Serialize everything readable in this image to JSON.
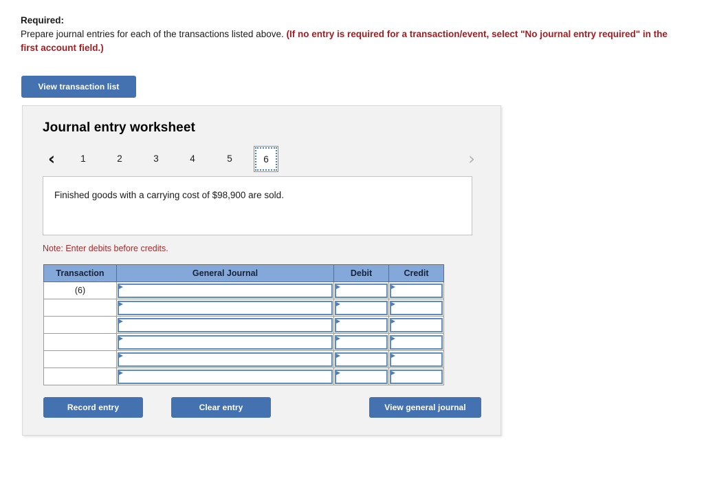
{
  "instructions": {
    "heading": "Required:",
    "body_plain": "Prepare journal entries for each of the transactions listed above. ",
    "body_emphasis": "(If no entry is required for a transaction/event, select \"No journal entry required\" in the first account field.)"
  },
  "toolbar": {
    "view_transaction_list": "View transaction list"
  },
  "worksheet": {
    "title": "Journal entry worksheet",
    "prev_icon": "chevron-left-icon",
    "next_icon": "chevron-right-icon",
    "prev_glyph": "‹",
    "next_glyph": "›",
    "tabs": [
      {
        "label": "1",
        "selected": false
      },
      {
        "label": "2",
        "selected": false
      },
      {
        "label": "3",
        "selected": false
      },
      {
        "label": "4",
        "selected": false
      },
      {
        "label": "5",
        "selected": false
      },
      {
        "label": "6",
        "selected": true
      }
    ],
    "description": "Finished goods with a carrying cost of $98,900 are sold.",
    "note": "Note: Enter debits before credits."
  },
  "table": {
    "columns": [
      "Transaction",
      "General Journal",
      "Debit",
      "Credit"
    ],
    "rows": [
      {
        "transaction": "(6)",
        "journal": "",
        "debit": "",
        "credit": ""
      },
      {
        "transaction": "",
        "journal": "",
        "debit": "",
        "credit": ""
      },
      {
        "transaction": "",
        "journal": "",
        "debit": "",
        "credit": ""
      },
      {
        "transaction": "",
        "journal": "",
        "debit": "",
        "credit": ""
      },
      {
        "transaction": "",
        "journal": "",
        "debit": "",
        "credit": ""
      },
      {
        "transaction": "",
        "journal": "",
        "debit": "",
        "credit": ""
      }
    ]
  },
  "actions": {
    "record_entry": "Record entry",
    "clear_entry": "Clear entry",
    "view_general_journal": "View general journal"
  },
  "colors": {
    "button_blue": "#4472b0",
    "header_blue": "#85a8db",
    "input_border_blue": "#5b8ac5",
    "emphasis_red": "#a51c20",
    "note_red": "#a52a2a",
    "card_bg": "#f2f2f2"
  }
}
